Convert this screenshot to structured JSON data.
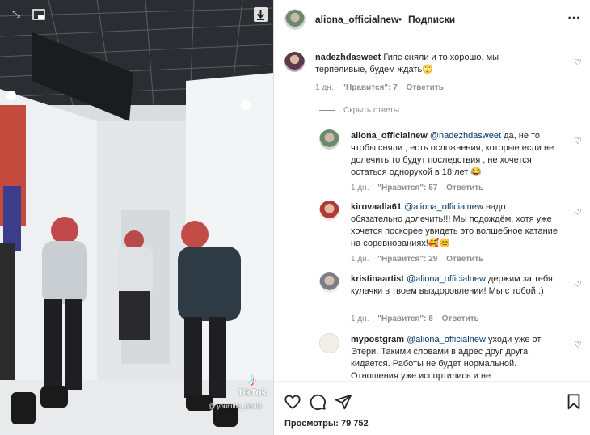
{
  "media": {
    "tiktok_word": "TikTok",
    "tiktok_handle": "@ yourlittle_devil3",
    "icons": [
      "expand-icon",
      "picture-in-picture-icon",
      "download-icon",
      "tiktok-logo-icon"
    ]
  },
  "header": {
    "username": "aliona_officialnew",
    "separator": "•",
    "follow_label": "Подписки",
    "more_label": "⋯"
  },
  "comments": [
    {
      "user": "nadezhdasweet",
      "mention": "",
      "text": "Гипс сняли и то хорошо, мы терпеливые, будем ждать🙄",
      "time": "1 дн.",
      "likes": "\"Нравится\": 7",
      "reply": "Ответить"
    }
  ],
  "hide_replies_label": "Скрыть ответы",
  "replies": [
    {
      "user": "aliona_officialnew",
      "mention": "@nadezhdasweet",
      "text": "да, не то чтобы сняли , есть осложнения, которые если не долечить то будут последствия , не хочется остаться однорукой в 18 лет 😂",
      "time": "1 дн.",
      "likes": "\"Нравится\": 57",
      "reply": "Ответить"
    },
    {
      "user": "kirovaalla61",
      "mention": "@aliona_officialnew",
      "text": "надо обязательно долечить!!! Мы подождём, хотя уже хочется поскорее увидеть это волшебное катание на соревнованиях!🥰😊",
      "time": "1 дн.",
      "likes": "\"Нравится\": 29",
      "reply": "Ответить"
    },
    {
      "user": "kristinaartist",
      "mention": "@aliona_officialnew",
      "text": "держим за тебя кулачки в твоем выздоровлении! Мы с тобой :)",
      "time": "1 дн.",
      "likes": "\"Нравится\": 8",
      "reply": "Ответить"
    },
    {
      "user": "mypostgram",
      "mention": "@aliona_officialnew",
      "text": "уходи уже от Этери. Такими словами в адрес друг друга кидается. Работы не будет нормальной. Отношения уже испортились и не",
      "time": "",
      "likes": "",
      "reply": ""
    }
  ],
  "actions": {
    "icons": [
      "heart-icon",
      "comment-icon",
      "share-icon",
      "bookmark-icon"
    ],
    "views": "Просмотры: 79 752"
  }
}
